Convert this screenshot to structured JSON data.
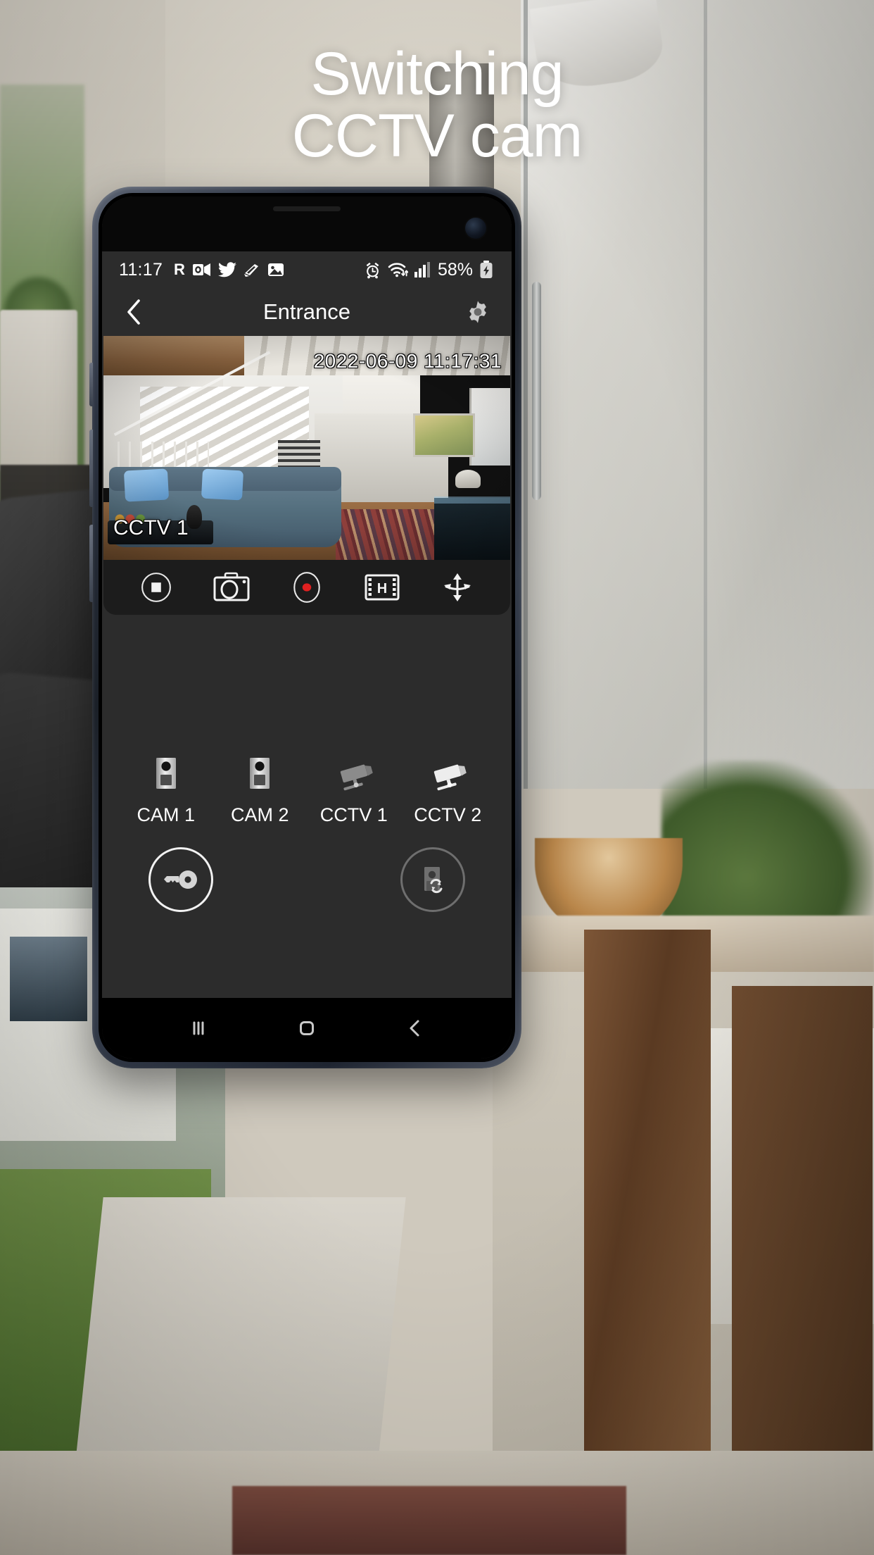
{
  "headline": {
    "line1": "Switching",
    "line2": "CCTV cam"
  },
  "phone": {
    "statusbar": {
      "time": "11:17",
      "left_icons": [
        "roaming-r-icon",
        "outlook-icon",
        "twitter-icon",
        "shazam-icon",
        "gallery-icon"
      ],
      "right_icons": [
        "alarm-icon",
        "wifi-icon",
        "cellular-signal-icon"
      ],
      "battery_percent": "58%",
      "battery_icon": "battery-charging-icon"
    },
    "appbar": {
      "back_icon": "back-chevron-icon",
      "title": "Entrance",
      "settings_icon": "gear-icon"
    },
    "video": {
      "timestamp": "2022-06-09 11:17:31",
      "camera_label": "CCTV 1"
    },
    "video_controls": [
      {
        "name": "stop-button",
        "icon": "stop-square-in-circle-icon",
        "label": "Stop"
      },
      {
        "name": "snapshot-button",
        "icon": "camera-icon",
        "label": "Snapshot"
      },
      {
        "name": "record-button",
        "icon": "record-dot-in-circle-icon",
        "label": "Record"
      },
      {
        "name": "quality-button",
        "icon": "filmstrip-h-icon",
        "label": "H"
      },
      {
        "name": "pan-tilt-button",
        "icon": "pan-tilt-arrows-icon",
        "label": "Pan / Tilt"
      }
    ],
    "cameras": [
      {
        "label": "CAM 1",
        "icon": "doorbell-camera-icon",
        "active": false
      },
      {
        "label": "CAM 2",
        "icon": "doorbell-camera-icon",
        "active": false
      },
      {
        "label": "CCTV 1",
        "icon": "cctv-camera-icon",
        "active": true
      },
      {
        "label": "CCTV 2",
        "icon": "cctv-camera-icon",
        "active": false
      }
    ],
    "actions": [
      {
        "name": "unlock-button",
        "icon": "key-icon",
        "label": "Unlock",
        "enabled": true
      },
      {
        "name": "switch-camera-button",
        "icon": "camera-switch-refresh-icon",
        "label": "Switch camera",
        "enabled": false
      }
    ],
    "navbar": [
      {
        "name": "recents-button",
        "icon": "recents-bars-icon"
      },
      {
        "name": "home-button",
        "icon": "home-square-icon"
      },
      {
        "name": "back-button",
        "icon": "back-chevron-icon"
      }
    ]
  },
  "colors": {
    "screen_bg": "#2c2c2c",
    "toolbar_bg": "#1c1c1c",
    "accent_record": "#e02020",
    "text_primary": "#ffffff",
    "icon_dim": "#6e6e6e"
  }
}
